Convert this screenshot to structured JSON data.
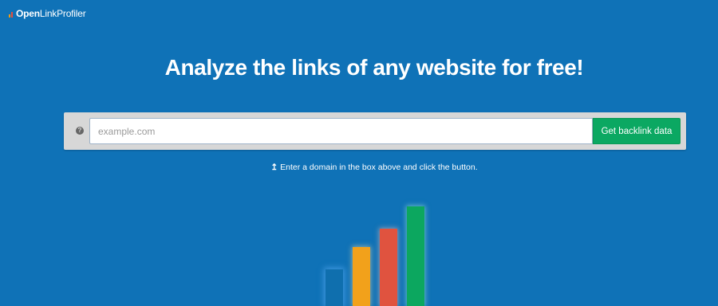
{
  "header": {
    "logo_bold": "Open",
    "logo_rest": "LinkProfiler"
  },
  "hero": {
    "title": "Analyze the links of any website for free!"
  },
  "search": {
    "help_glyph": "?",
    "placeholder": "example.com",
    "value": "",
    "button_label": "Get backlink data"
  },
  "hint": {
    "arrow": "↥",
    "text": "Enter a domain in the box above and click the button."
  },
  "illustration": {
    "bars": [
      {
        "color": "#0f6fae",
        "level": 0.37
      },
      {
        "color": "#f2a11b",
        "level": 0.59
      },
      {
        "color": "#e0533f",
        "level": 0.78
      },
      {
        "color": "#0ca75f",
        "level": 1.0
      }
    ]
  },
  "colors": {
    "background": "#0f72b7",
    "button": "#0ba862"
  },
  "icons": {
    "logo": "bar-chart-logo-icon",
    "help": "question-circle-icon",
    "hint": "arrow-up-icon"
  }
}
